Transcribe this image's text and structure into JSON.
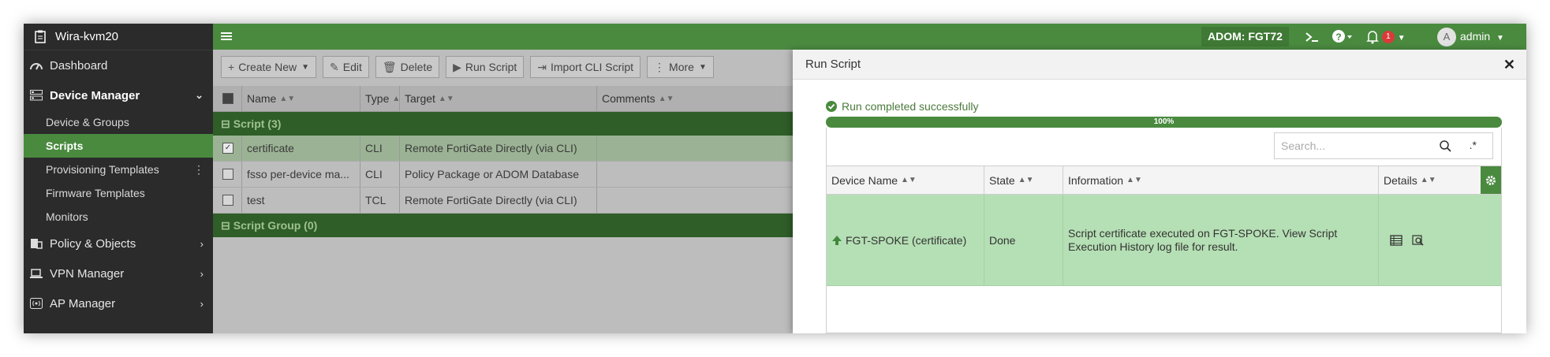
{
  "sidebar": {
    "host": "Wira-kvm20",
    "nav": [
      {
        "label": "Dashboard"
      },
      {
        "label": "Device Manager"
      }
    ],
    "device_manager_sub": [
      {
        "label": "Device & Groups"
      },
      {
        "label": "Scripts"
      },
      {
        "label": "Provisioning Templates"
      },
      {
        "label": "Firmware Templates"
      },
      {
        "label": "Monitors"
      }
    ],
    "more_nav": [
      {
        "label": "Policy & Objects"
      },
      {
        "label": "VPN Manager"
      },
      {
        "label": "AP Manager"
      }
    ]
  },
  "topbar": {
    "adom": "ADOM: FGT72",
    "notification_count": "1",
    "avatar_letter": "A",
    "user": "admin"
  },
  "toolbar": {
    "create_new": "Create New",
    "edit": "Edit",
    "delete": "Delete",
    "run_script": "Run Script",
    "import_cli": "Import CLI Script",
    "more": "More"
  },
  "grid": {
    "columns": [
      "Name",
      "Type",
      "Target",
      "Comments"
    ],
    "group1": "Script (3)",
    "rows": [
      {
        "name": "certificate",
        "type": "CLI",
        "target": "Remote FortiGate Directly (via CLI)"
      },
      {
        "name": "fsso per-device ma...",
        "type": "CLI",
        "target": "Policy Package or ADOM Database"
      },
      {
        "name": "test",
        "type": "TCL",
        "target": "Remote FortiGate Directly (via CLI)"
      }
    ],
    "group2": "Script Group (0)"
  },
  "dialog": {
    "title": "Run Script",
    "status": "Run completed successfully",
    "progress_label": "100%",
    "progress_value": 1.0,
    "search_placeholder": "Search...",
    "columns": [
      "Device Name",
      "State",
      "Information",
      "Details"
    ],
    "result": {
      "device": "FGT-SPOKE (certificate)",
      "state": "Done",
      "information": "Script certificate executed on FGT-SPOKE. View Script Execution History log file for result."
    }
  },
  "colors": {
    "accent": "#4a8a3f",
    "sidebar_bg": "#2b2b2b",
    "success_row": "#b5dfb4",
    "badge": "#d93b3b"
  }
}
